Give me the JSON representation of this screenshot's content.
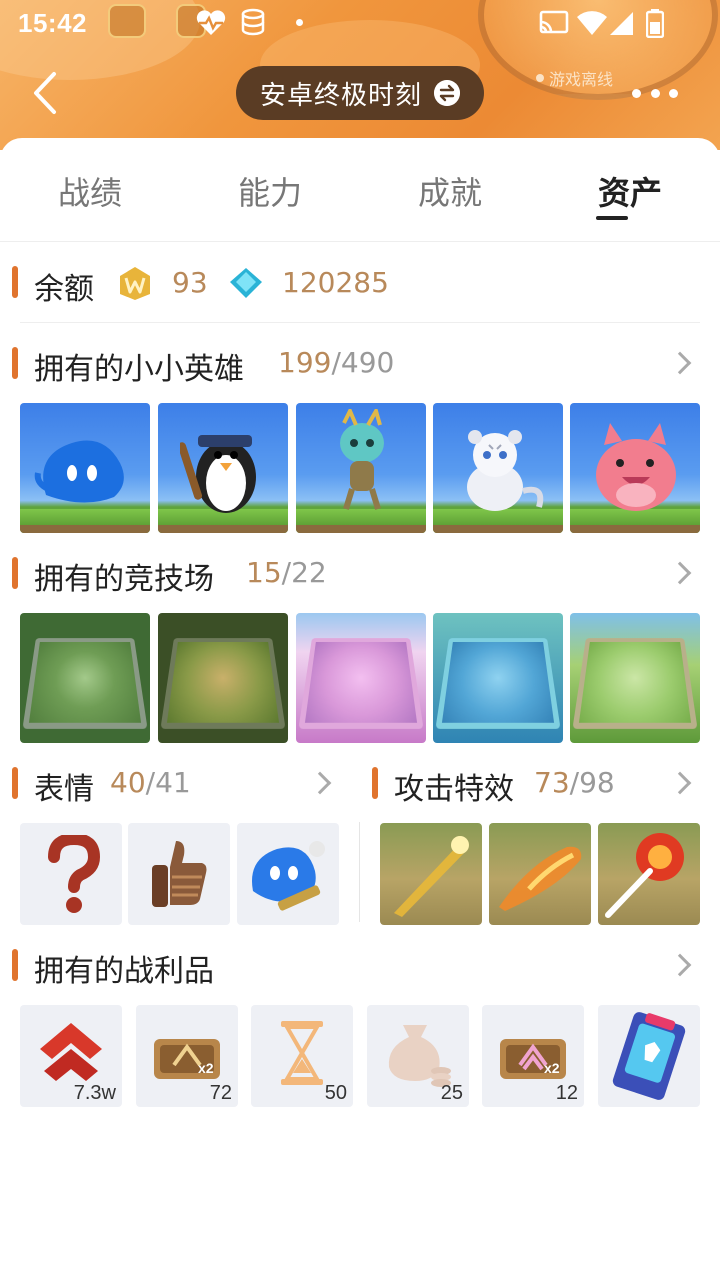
{
  "status_bar": {
    "time": "15:42"
  },
  "header": {
    "title": "安卓终极时刻",
    "offline_label": "游戏离线"
  },
  "tabs": [
    {
      "label": "战绩",
      "active": false
    },
    {
      "label": "能力",
      "active": false
    },
    {
      "label": "成就",
      "active": false
    },
    {
      "label": "资产",
      "active": true
    }
  ],
  "balance": {
    "title": "余额",
    "coin_value": "93",
    "gem_value": "120285"
  },
  "heroes": {
    "title": "拥有的小小英雄",
    "owned": "199",
    "total": "/490",
    "items": [
      {
        "icon": "blue-spirit-hero"
      },
      {
        "icon": "penguin-hero"
      },
      {
        "icon": "dragon-hero"
      },
      {
        "icon": "white-tiger-hero"
      },
      {
        "icon": "pink-cat-hero"
      }
    ]
  },
  "arenas": {
    "title": "拥有的竞技场",
    "owned": "15",
    "total": "/22",
    "items": [
      {
        "icon": "green-vortex-arena",
        "color": "#5e8f46"
      },
      {
        "icon": "jungle-arena",
        "color": "#6d8a3c"
      },
      {
        "icon": "pink-arena",
        "color": "#d89ad6"
      },
      {
        "icon": "blue-arena",
        "color": "#4fa0c8"
      },
      {
        "icon": "meadow-arena",
        "color": "#8cc45a"
      }
    ]
  },
  "emotes": {
    "title": "表情",
    "owned": "40",
    "total": "/41",
    "items": [
      {
        "icon": "question-mark-emote"
      },
      {
        "icon": "thumbs-up-emote"
      },
      {
        "icon": "blue-spirit-emote"
      }
    ]
  },
  "effects": {
    "title": "攻击特效",
    "owned": "73",
    "total": "/98",
    "items": [
      {
        "icon": "golden-strike-effect"
      },
      {
        "icon": "fire-streak-effect"
      },
      {
        "icon": "red-burst-effect"
      }
    ]
  },
  "loot": {
    "title": "拥有的战利品",
    "items": [
      {
        "icon": "rank-chevron-icon",
        "count": "7.3w"
      },
      {
        "icon": "double-bronze-chest-icon",
        "count": "72"
      },
      {
        "icon": "hourglass-icon",
        "count": "50"
      },
      {
        "icon": "coin-bag-icon",
        "count": "25"
      },
      {
        "icon": "double-pink-chest-icon",
        "count": "12"
      },
      {
        "icon": "arcade-card-icon",
        "count": ""
      }
    ]
  }
}
